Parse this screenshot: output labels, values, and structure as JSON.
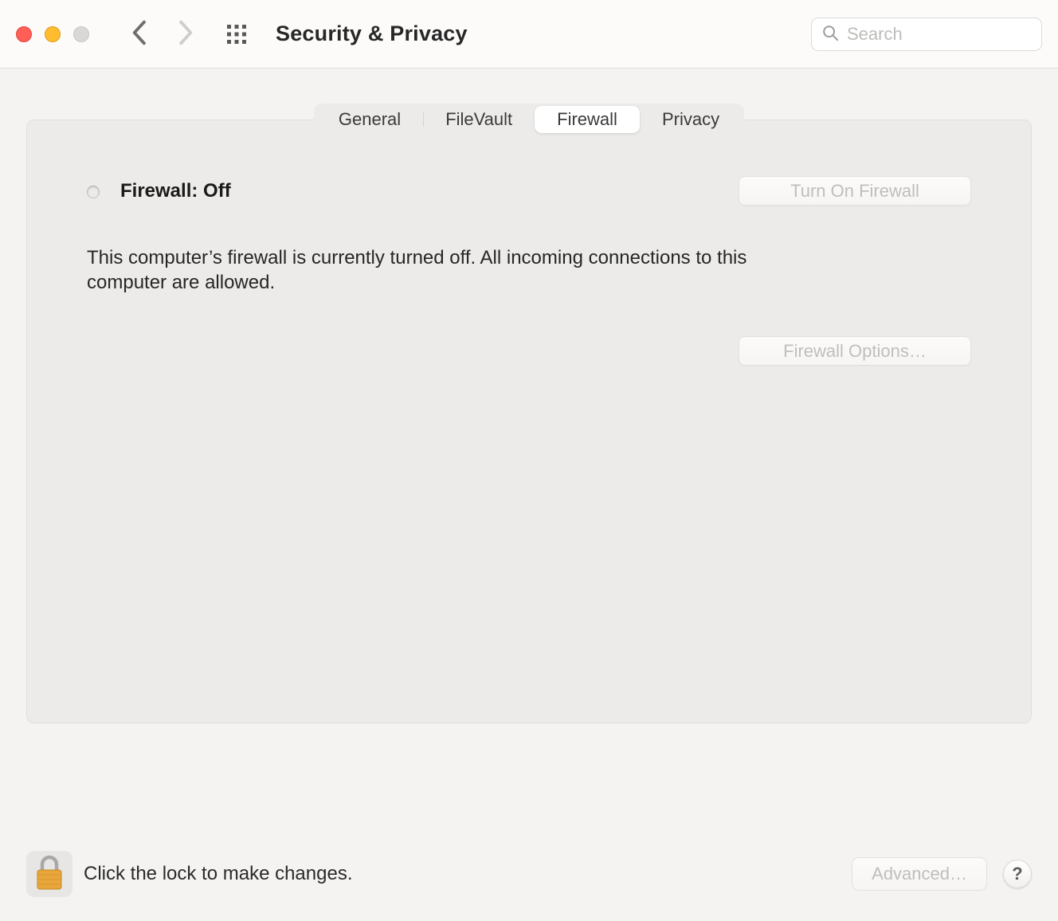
{
  "window": {
    "title": "Security & Privacy"
  },
  "search": {
    "placeholder": "Search",
    "value": ""
  },
  "tabs": {
    "general": "General",
    "filevault": "FileVault",
    "firewall": "Firewall",
    "privacy": "Privacy",
    "active": "Firewall"
  },
  "firewall": {
    "status_label": "Firewall: Off",
    "turn_on_label": "Turn On Firewall",
    "description": "This computer’s firewall is currently turned off. All incoming connections to this computer are allowed.",
    "options_label": "Firewall Options…"
  },
  "footer": {
    "lock_text": "Click the lock to make changes.",
    "advanced_label": "Advanced…",
    "help_label": "?"
  }
}
